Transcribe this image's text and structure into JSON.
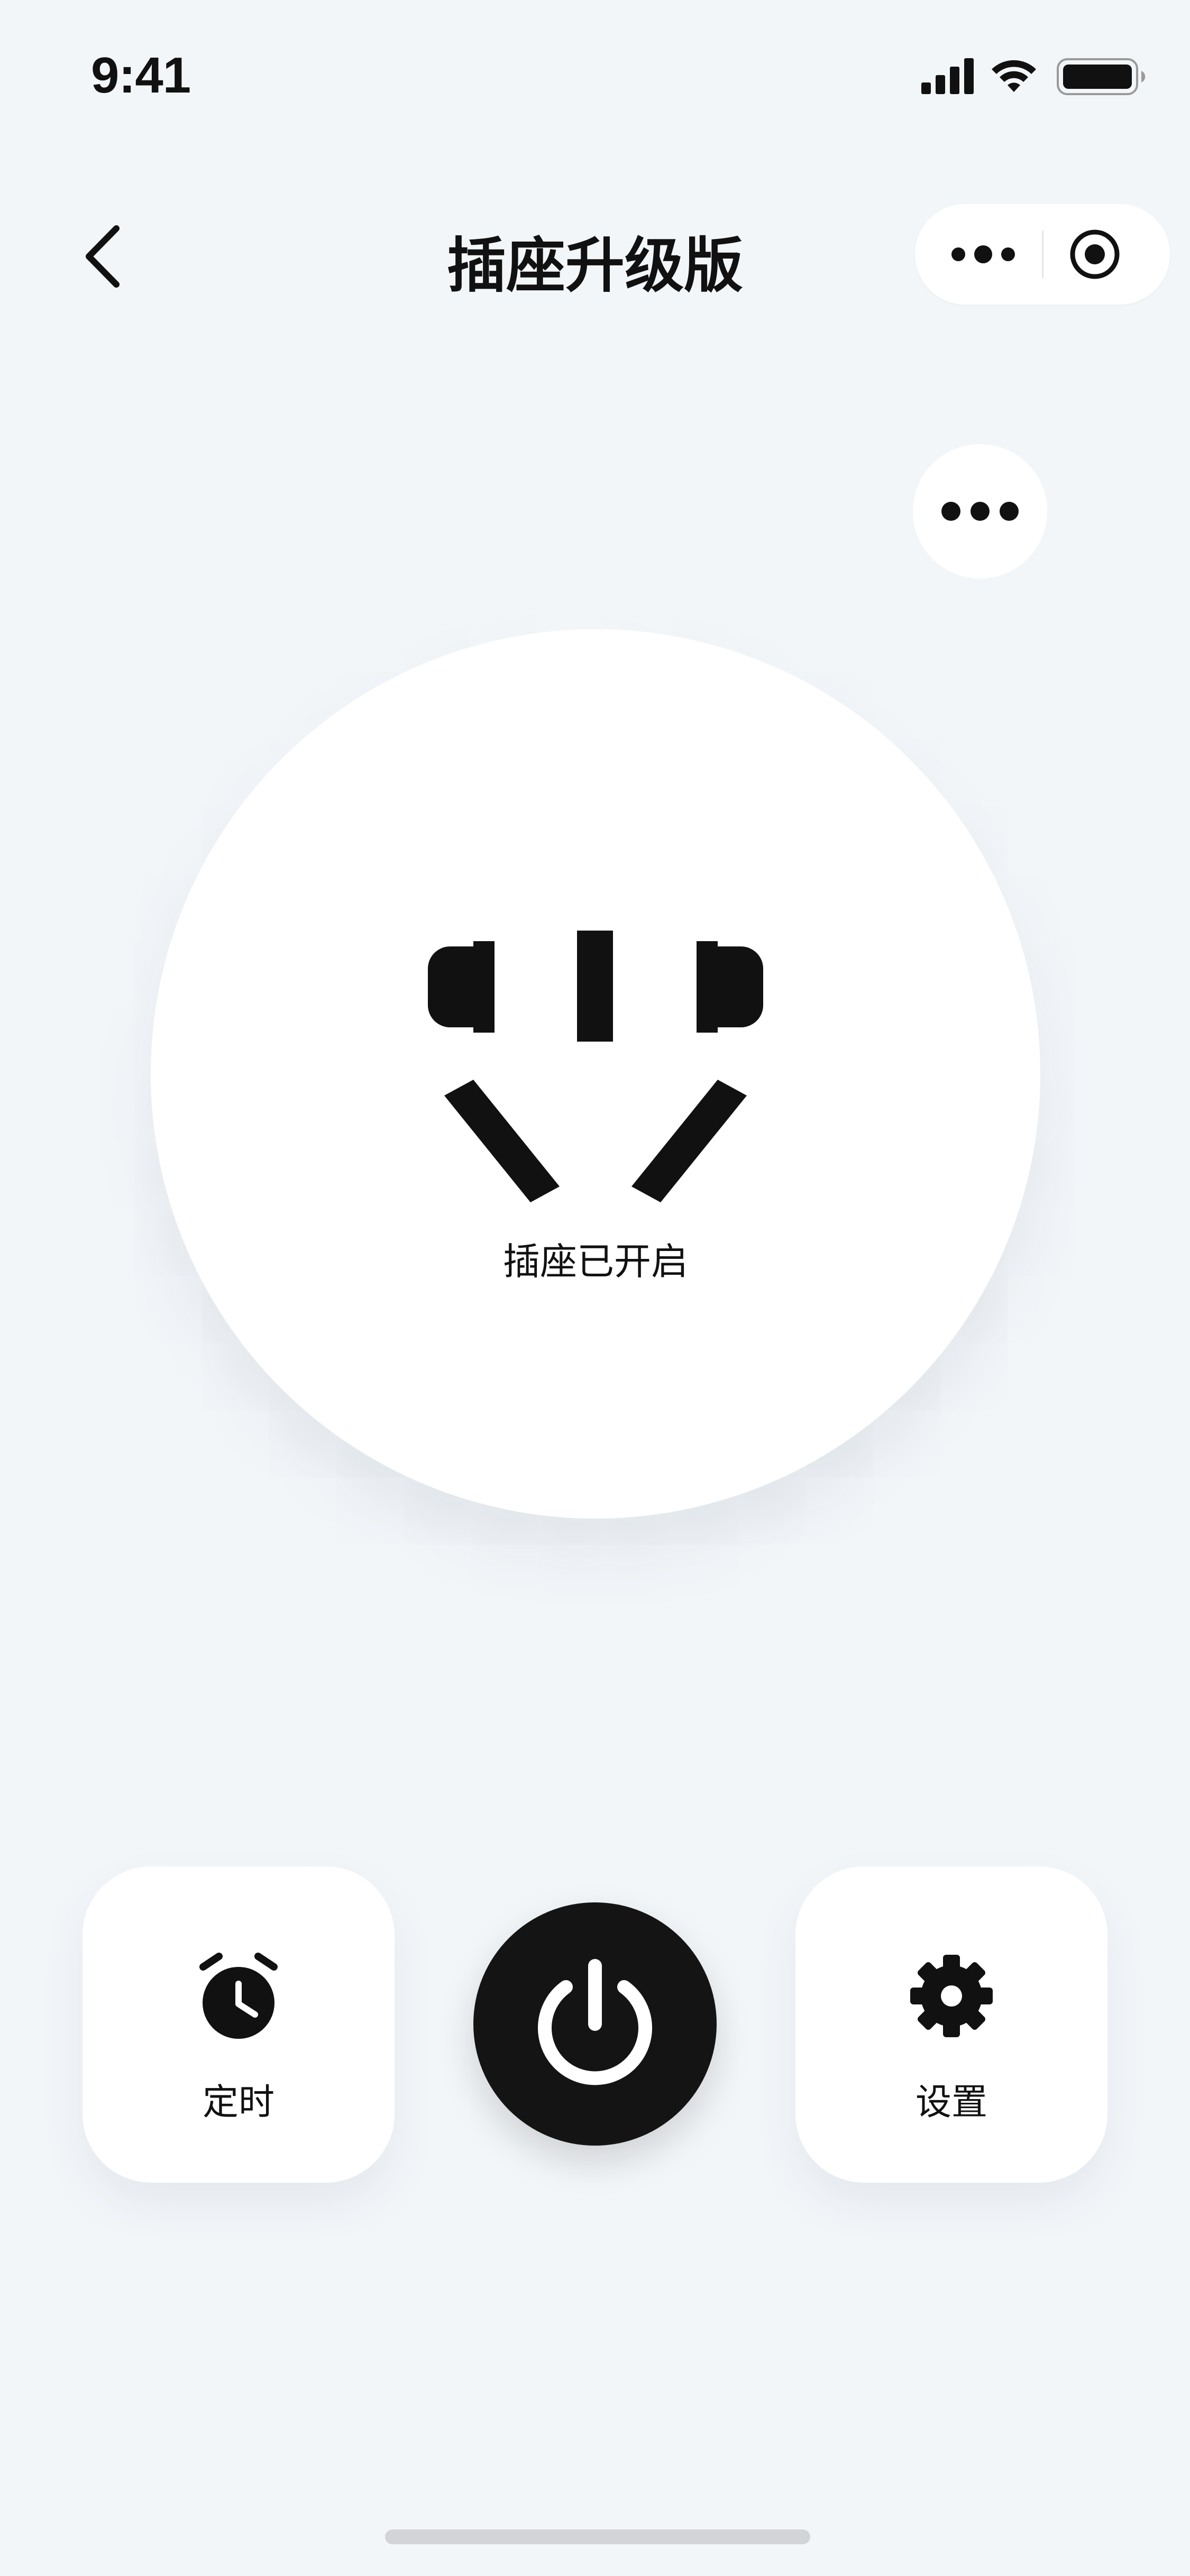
{
  "status_bar": {
    "time": "9:41",
    "icons": [
      "cellular-signal-icon",
      "wifi-icon",
      "battery-icon"
    ]
  },
  "nav": {
    "title": "插座升级版",
    "back_icon": "chevron-left-icon",
    "capsule_icons": [
      "more-dots-icon",
      "close-target-icon"
    ]
  },
  "device": {
    "more_icon": "more-dots-icon",
    "socket_icon": "socket-outlet-icon",
    "status_text": "插座已开启",
    "power_on": true
  },
  "controls": {
    "timer_label": "定时",
    "timer_icon": "alarm-clock-icon",
    "power_icon": "power-icon",
    "settings_label": "设置",
    "settings_icon": "gear-icon"
  },
  "colors": {
    "background": "#f3f6f9",
    "card": "#ffffff",
    "primary": "#111111",
    "power_button": "#141414"
  }
}
